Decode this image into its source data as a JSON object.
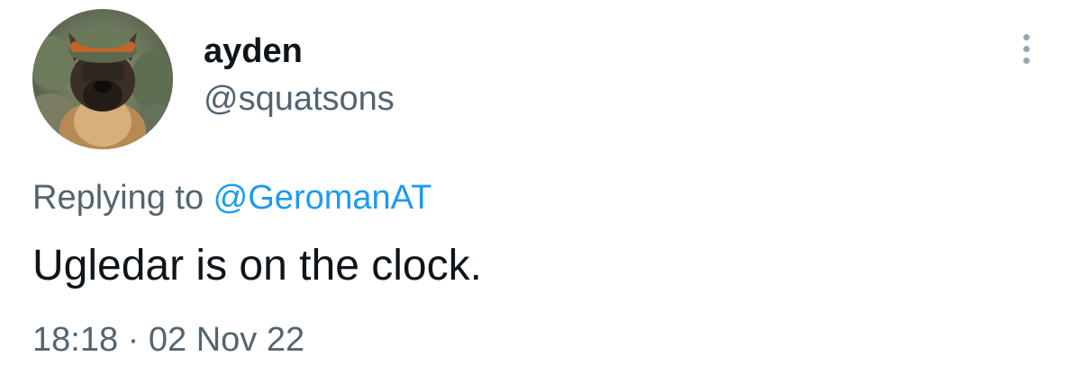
{
  "author": {
    "display_name": "ayden",
    "handle": "@squatsons",
    "avatar_icon": "dog-with-hat-avatar"
  },
  "reply": {
    "prefix": "Replying to ",
    "mention": "@GeromanAT"
  },
  "tweet": {
    "text": "Ugledar is on the clock."
  },
  "meta": {
    "time": "18:18",
    "separator": " · ",
    "date": "02 Nov 22"
  },
  "menu": {
    "icon": "more-vertical-icon"
  },
  "colors": {
    "text_primary": "#0f1419",
    "text_secondary": "#536471",
    "link": "#1d9bf0"
  }
}
